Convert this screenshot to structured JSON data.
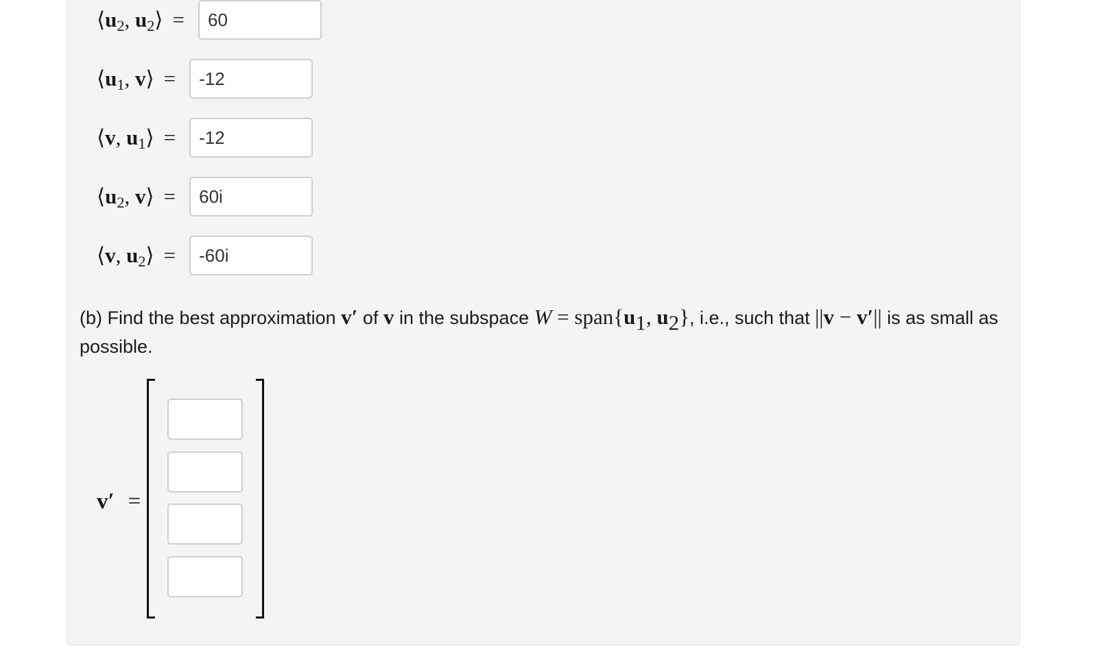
{
  "inner_products": [
    {
      "first": "u",
      "first_sub": "2",
      "second": "u",
      "second_sub": "2",
      "value": "60"
    },
    {
      "first": "u",
      "first_sub": "1",
      "second": "v",
      "second_sub": "",
      "value": "-12"
    },
    {
      "first": "v",
      "first_sub": "",
      "second": "u",
      "second_sub": "1",
      "value": "-12"
    },
    {
      "first": "u",
      "first_sub": "2",
      "second": "v",
      "second_sub": "",
      "value": "60i"
    },
    {
      "first": "v",
      "first_sub": "",
      "second": "u",
      "second_sub": "2",
      "value": "-60i"
    }
  ],
  "part_b": {
    "t1": "(b) Find the best approximation ",
    "vprime": "v′",
    "t2": " of ",
    "v": "v",
    "t3": " in the subspace ",
    "W": "W",
    "eq_span": " = span{",
    "u": "u",
    "sub1": "1",
    "sub2": "2",
    "close": "}",
    "t4": ", i.e., such that ",
    "norm_open": "||",
    "minus": " − ",
    "norm_close": "||",
    "t5": " is as small as possible."
  },
  "answer": {
    "label": "v′",
    "equals": "=",
    "entries": [
      "",
      "",
      "",
      ""
    ]
  }
}
